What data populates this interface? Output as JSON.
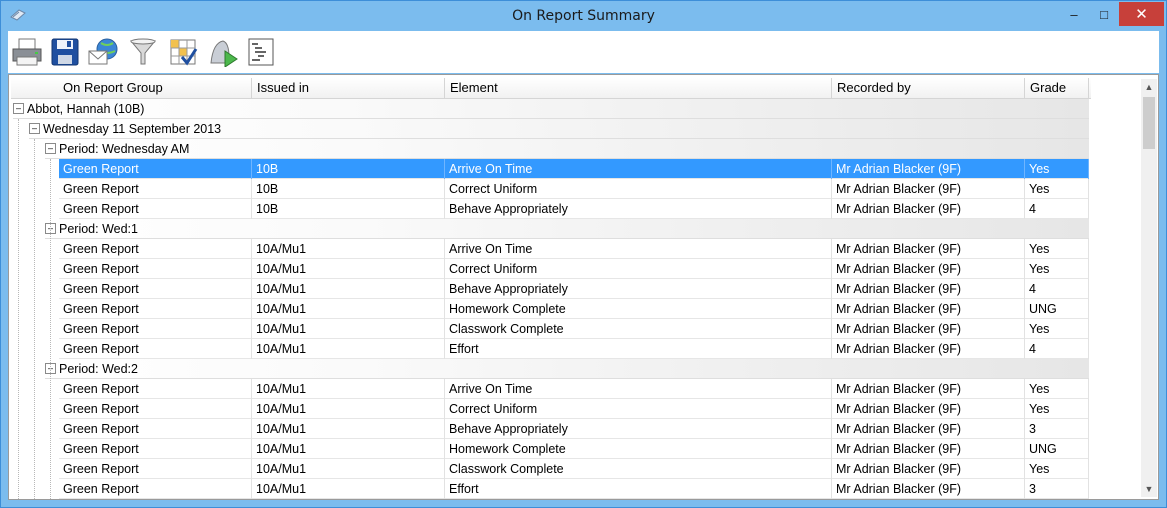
{
  "window": {
    "title": "On Report Summary",
    "minimize_glyph": "–",
    "maximize_glyph": "□",
    "close_glyph": "✕"
  },
  "toolbar": {
    "buttons": [
      {
        "icon": "printer-icon"
      },
      {
        "icon": "save-icon"
      },
      {
        "icon": "email-icon"
      },
      {
        "icon": "filter-icon"
      },
      {
        "icon": "grid-check-icon"
      },
      {
        "icon": "run-report-icon"
      },
      {
        "icon": "tree-outline-icon"
      }
    ]
  },
  "grid": {
    "columns": [
      "On Report Group",
      "Issued in",
      "Element",
      "Recorded by",
      "Grade"
    ],
    "collapse_glyph": "–",
    "student": "Abbot, Hannah (10B)",
    "date": "Wednesday 11 September 2013",
    "periods": [
      {
        "label": "Period: Wednesday AM",
        "rows": [
          [
            "Green Report",
            "10B",
            "Arrive On Time",
            "Mr Adrian Blacker (9F)",
            "Yes"
          ],
          [
            "Green Report",
            "10B",
            "Correct Uniform",
            "Mr Adrian Blacker (9F)",
            "Yes"
          ],
          [
            "Green Report",
            "10B",
            "Behave Appropriately",
            "Mr Adrian Blacker (9F)",
            "4"
          ]
        ]
      },
      {
        "label": "Period: Wed:1",
        "rows": [
          [
            "Green Report",
            "10A/Mu1",
            "Arrive On Time",
            "Mr Adrian Blacker (9F)",
            "Yes"
          ],
          [
            "Green Report",
            "10A/Mu1",
            "Correct Uniform",
            "Mr Adrian Blacker (9F)",
            "Yes"
          ],
          [
            "Green Report",
            "10A/Mu1",
            "Behave Appropriately",
            "Mr Adrian Blacker (9F)",
            "4"
          ],
          [
            "Green Report",
            "10A/Mu1",
            "Homework Complete",
            "Mr Adrian Blacker (9F)",
            "UNG"
          ],
          [
            "Green Report",
            "10A/Mu1",
            "Classwork Complete",
            "Mr Adrian Blacker (9F)",
            "Yes"
          ],
          [
            "Green Report",
            "10A/Mu1",
            "Effort",
            "Mr Adrian Blacker (9F)",
            "4"
          ]
        ]
      },
      {
        "label": "Period: Wed:2",
        "rows": [
          [
            "Green Report",
            "10A/Mu1",
            "Arrive On Time",
            "Mr Adrian Blacker (9F)",
            "Yes"
          ],
          [
            "Green Report",
            "10A/Mu1",
            "Correct Uniform",
            "Mr Adrian Blacker (9F)",
            "Yes"
          ],
          [
            "Green Report",
            "10A/Mu1",
            "Behave Appropriately",
            "Mr Adrian Blacker (9F)",
            "3"
          ],
          [
            "Green Report",
            "10A/Mu1",
            "Homework Complete",
            "Mr Adrian Blacker (9F)",
            "UNG"
          ],
          [
            "Green Report",
            "10A/Mu1",
            "Classwork Complete",
            "Mr Adrian Blacker (9F)",
            "Yes"
          ],
          [
            "Green Report",
            "10A/Mu1",
            "Effort",
            "Mr Adrian Blacker (9F)",
            "3"
          ]
        ]
      }
    ],
    "selected_row": {
      "period": 0,
      "row": 0
    }
  },
  "scrollbar": {
    "up_glyph": "▲",
    "down_glyph": "▼"
  }
}
